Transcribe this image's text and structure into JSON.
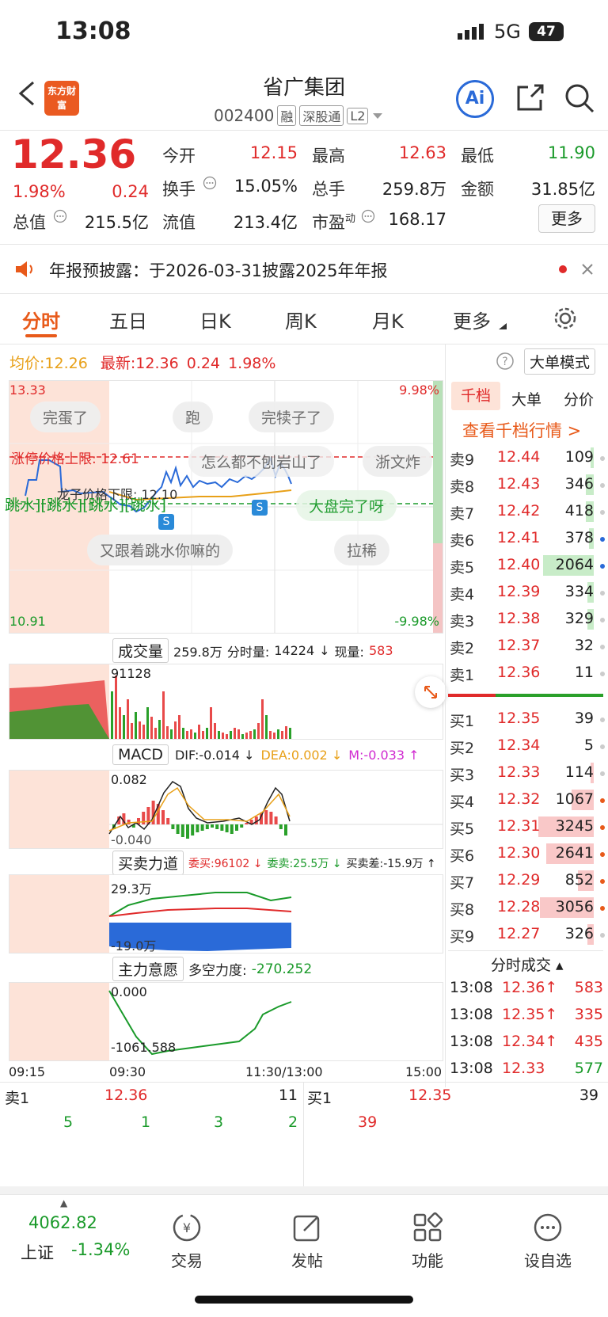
{
  "status_bar": {
    "time": "13:08",
    "network": "5G",
    "battery": "47"
  },
  "header": {
    "title": "省广集团",
    "code": "002400",
    "tags": [
      "融",
      "深股通",
      "L2"
    ],
    "logo_text": "东方财富",
    "ai_label": "Ai"
  },
  "quote": {
    "price": "12.36",
    "change_pct": "1.98%",
    "change": "0.24",
    "open_label": "今开",
    "open": "12.15",
    "high_label": "最高",
    "high": "12.63",
    "low_label": "最低",
    "low": "11.90",
    "turnover_label": "换手",
    "turnover": "15.05%",
    "volume_label": "总手",
    "volume": "259.8万",
    "amount_label": "金额",
    "amount": "31.85亿",
    "mcap_label": "总值",
    "mcap": "215.5亿",
    "float_label": "流值",
    "float": "213.4亿",
    "pe_label": "市盈",
    "pe_sup": "动",
    "pe": "168.17",
    "more": "更多"
  },
  "notice": {
    "text": "年报预披露：于2026-03-31披露2025年年报"
  },
  "tabs": [
    {
      "label": "分时",
      "active": true
    },
    {
      "label": "五日"
    },
    {
      "label": "日K"
    },
    {
      "label": "周K"
    },
    {
      "label": "月K"
    },
    {
      "label": "更多"
    }
  ],
  "chart_info": {
    "avg_label": "均价:",
    "avg": "12.26",
    "last_label": "最新:",
    "last": "12.36",
    "chg": "0.24",
    "pct": "1.98%",
    "bigmode": "大单模式"
  },
  "price_chart": {
    "y_max": "13.33",
    "y_min": "10.91",
    "pct_max": "9.98%",
    "pct_min": "-9.98%",
    "limit_label": "涨停价格上限: 12.61",
    "price_label": "龙子价格下限: 12.10",
    "bubbles": [
      "完蛋了",
      "跑",
      "完犊子了",
      "怎么都不刨岩山了",
      "浙文炸",
      "大盘完了呀",
      "又跟着跳水你嘛的",
      "拉稀"
    ],
    "jump_text": "跳水][跳水][跳水][跳水]",
    "s_mark": "S"
  },
  "volume_panel": {
    "title": "成交量",
    "total": "259.8万",
    "period_label": "分时量:",
    "period": "14224",
    "now_label": "现量:",
    "now": "583",
    "max": "91128"
  },
  "macd_panel": {
    "title": "MACD",
    "dif": "DIF:-0.014 ↓",
    "dea": "DEA:0.002 ↓",
    "m": "M:-0.033 ↑",
    "max": "0.082",
    "min": "-0.040"
  },
  "force_panel": {
    "title": "买卖力道",
    "wb": "委买:96102 ↓",
    "ws": "委卖:25.5万 ↓",
    "diff": "买卖差:-15.9万 ↑",
    "max": "29.3万",
    "min": "-19.0万"
  },
  "main_panel": {
    "title": "主力意愿",
    "label": "多空力度:",
    "val": "-270.252",
    "max": "0.000",
    "min": "-1061.588"
  },
  "time_axis": [
    "09:15",
    "09:30",
    "11:30/13:00",
    "15:00"
  ],
  "orderbook": {
    "tabs": [
      "千档",
      "大单",
      "分价"
    ],
    "promo": "查看千档行情 >",
    "asks": [
      {
        "label": "卖9",
        "price": "12.44",
        "vol": "109"
      },
      {
        "label": "卖8",
        "price": "12.43",
        "vol": "346"
      },
      {
        "label": "卖7",
        "price": "12.42",
        "vol": "418"
      },
      {
        "label": "卖6",
        "price": "12.41",
        "vol": "378"
      },
      {
        "label": "卖5",
        "price": "12.40",
        "vol": "2064"
      },
      {
        "label": "卖4",
        "price": "12.39",
        "vol": "334"
      },
      {
        "label": "卖3",
        "price": "12.38",
        "vol": "329"
      },
      {
        "label": "卖2",
        "price": "12.37",
        "vol": "32"
      },
      {
        "label": "卖1",
        "price": "12.36",
        "vol": "11"
      }
    ],
    "bids": [
      {
        "label": "买1",
        "price": "12.35",
        "vol": "39"
      },
      {
        "label": "买2",
        "price": "12.34",
        "vol": "5"
      },
      {
        "label": "买3",
        "price": "12.33",
        "vol": "114"
      },
      {
        "label": "买4",
        "price": "12.32",
        "vol": "1067"
      },
      {
        "label": "买5",
        "price": "12.31",
        "vol": "3245"
      },
      {
        "label": "买6",
        "price": "12.30",
        "vol": "2641"
      },
      {
        "label": "买7",
        "price": "12.29",
        "vol": "852"
      },
      {
        "label": "买8",
        "price": "12.28",
        "vol": "3056"
      },
      {
        "label": "买9",
        "price": "12.27",
        "vol": "326"
      }
    ],
    "trades_title": "分时成交",
    "trades": [
      {
        "time": "13:08",
        "price": "12.36↑",
        "vol": "583"
      },
      {
        "time": "13:08",
        "price": "12.35↑",
        "vol": "335"
      },
      {
        "time": "13:08",
        "price": "12.34↑",
        "vol": "435"
      },
      {
        "time": "13:08",
        "price": "12.33",
        "vol": "577"
      }
    ]
  },
  "queue": {
    "ask_label": "卖1",
    "ask_price": "12.36",
    "ask_vol": "11",
    "ask_orders": [
      "5",
      "1",
      "3",
      "2"
    ],
    "bid_label": "买1",
    "bid_price": "12.35",
    "bid_vol": "39",
    "bid_orders": [
      "39"
    ]
  },
  "bottom_bar": {
    "index_value": "4062.82",
    "index_name": "上证",
    "index_pct": "-1.34%",
    "items": [
      "交易",
      "发帖",
      "功能",
      "设自选"
    ]
  }
}
